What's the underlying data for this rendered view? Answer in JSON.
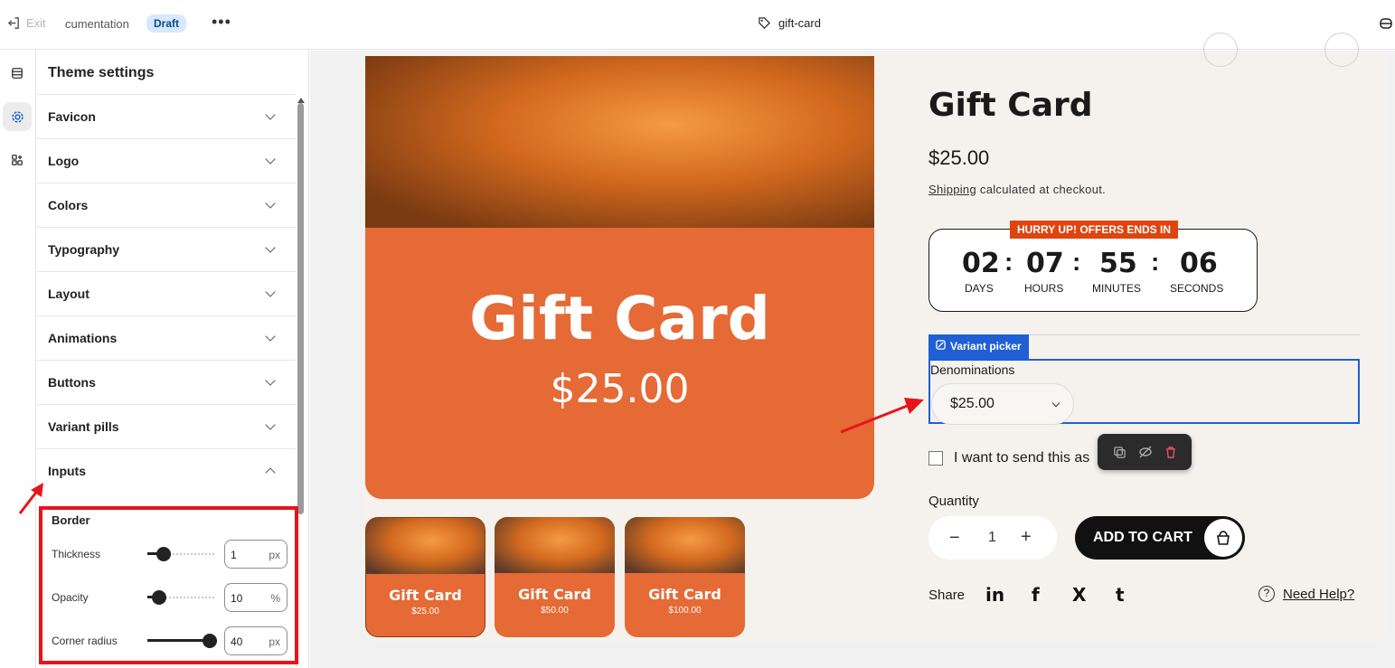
{
  "topbar": {
    "exit_label": "Exit",
    "doc_label": "cumentation",
    "status_badge": "Draft",
    "more_label": "•••",
    "page_name": "gift-card"
  },
  "rail": {
    "items": [
      {
        "icon": "sections-icon"
      },
      {
        "icon": "settings-icon",
        "active": true
      },
      {
        "icon": "apps-icon"
      }
    ]
  },
  "panel": {
    "title": "Theme settings",
    "sections": [
      "Favicon",
      "Logo",
      "Colors",
      "Typography",
      "Layout",
      "Animations",
      "Buttons",
      "Variant pills",
      "Inputs"
    ],
    "inputs": {
      "group_title": "Border",
      "thickness": {
        "label": "Thickness",
        "value": "1",
        "unit": "px",
        "level": 0.25
      },
      "opacity": {
        "label": "Opacity",
        "value": "10",
        "unit": "%",
        "level": 0.1
      },
      "corner_radius": {
        "label": "Corner radius",
        "value": "40",
        "unit": "px",
        "level": 1.0
      }
    }
  },
  "product": {
    "hero_title": "Gift Card",
    "hero_price": "$25.00",
    "title": "Gift Card",
    "price": "$25.00",
    "shipping_link": "Shipping",
    "shipping_rest": " calculated at checkout.",
    "countdown": {
      "banner": "HURRY UP! OFFERS ENDS IN",
      "days": "02",
      "days_label": "DAYS",
      "hours": "07",
      "hours_label": "HOURS",
      "minutes": "55",
      "minutes_label": "MINUTES",
      "seconds": "06",
      "seconds_label": "SECONDS"
    },
    "variant_tag": "Variant picker",
    "denominations_label": "Denominations",
    "denomination_value": "$25.00",
    "gift_checkbox_label": "I want to send this as",
    "quantity_label": "Quantity",
    "quantity_value": "1",
    "add_to_cart": "ADD TO CART",
    "share_label": "Share",
    "help_link": "Need Help?",
    "thumbnails": [
      {
        "title": "Gift Card",
        "price": "$25.00"
      },
      {
        "title": "Gift Card",
        "price": "$50.00"
      },
      {
        "title": "Gift Card",
        "price": "$100.00"
      }
    ]
  },
  "colors": {
    "accent_blue": "#1f5fd6",
    "highlight_red": "#e8141a",
    "gift_orange": "#e56a35",
    "banner_orange": "#e0440e"
  }
}
